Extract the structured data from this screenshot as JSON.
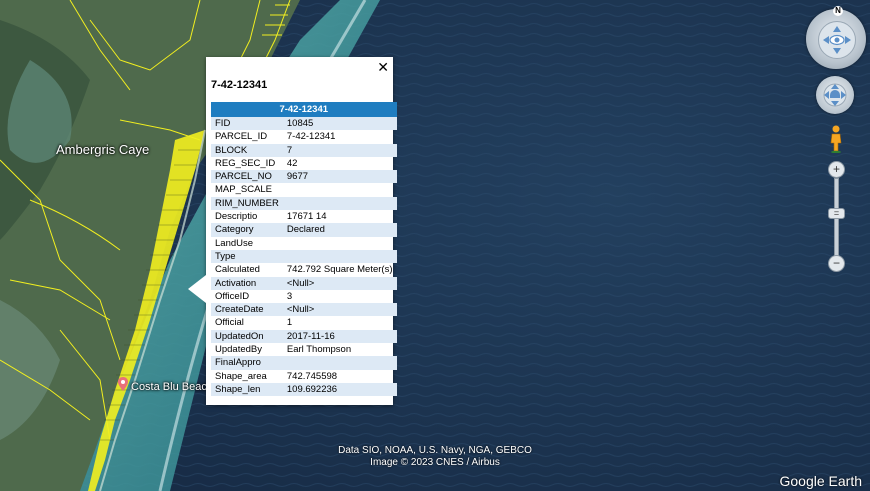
{
  "map": {
    "island_label": "Ambergris Caye",
    "place_label": "Costa Blu Beac",
    "attribution_line1": "Data SIO, NOAA, U.S. Navy, NGA, GEBCO",
    "attribution_line2": "Image © 2023 CNES / Airbus",
    "brand": "Google Earth",
    "colors": {
      "ocean": "#1e3553",
      "land": "#4f6a4c",
      "parcels": "#f2ef1f",
      "lagoon": "#2f8a93"
    }
  },
  "popup": {
    "title": "7-42-12341",
    "close_icon": "close-icon",
    "header": "7-42-12341",
    "rows": [
      {
        "key": "FID",
        "value": "10845"
      },
      {
        "key": "PARCEL_ID",
        "value": "7-42-12341"
      },
      {
        "key": "BLOCK",
        "value": "7"
      },
      {
        "key": "REG_SEC_ID",
        "value": "42"
      },
      {
        "key": "PARCEL_NO",
        "value": "9677"
      },
      {
        "key": "MAP_SCALE",
        "value": ""
      },
      {
        "key": "RIM_NUMBER",
        "value": ""
      },
      {
        "key": "Descriptio",
        "value": "17671 14"
      },
      {
        "key": "Category",
        "value": "Declared"
      },
      {
        "key": "LandUse",
        "value": ""
      },
      {
        "key": "Type",
        "value": ""
      },
      {
        "key": "Calculated",
        "value": "742.792 Square Meter(s)"
      },
      {
        "key": "Activation",
        "value": "<Null>"
      },
      {
        "key": "OfficeID",
        "value": "3"
      },
      {
        "key": "CreateDate",
        "value": "<Null>"
      },
      {
        "key": "Official",
        "value": "1"
      },
      {
        "key": "UpdatedOn",
        "value": "2017-11-16"
      },
      {
        "key": "UpdatedBy",
        "value": "Earl Thompson"
      },
      {
        "key": "FinalAppro",
        "value": ""
      },
      {
        "key": "Shape_area",
        "value": "742.745598"
      },
      {
        "key": "Shape_len",
        "value": "109.692236"
      }
    ]
  },
  "controls": {
    "north_label": "N",
    "zoom_in": "+",
    "zoom_out": "−",
    "zoom_handle": "=",
    "zoom_level": 0.42
  }
}
